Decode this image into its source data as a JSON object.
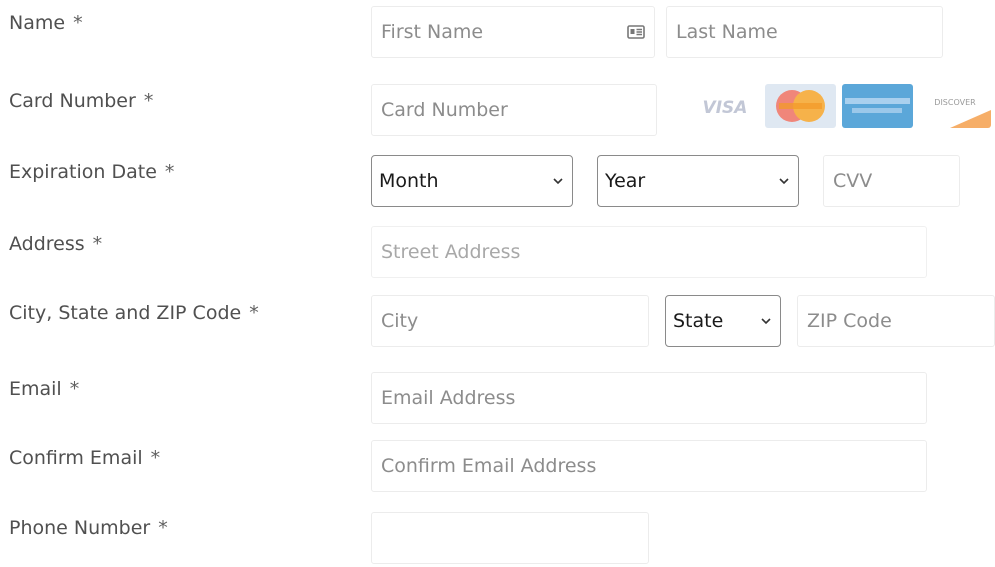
{
  "form": {
    "name": {
      "label": "Name",
      "required_mark": "*",
      "first_placeholder": "First Name",
      "last_placeholder": "Last Name"
    },
    "card_number": {
      "label": "Card Number",
      "required_mark": "*",
      "placeholder": "Card Number",
      "accepted_cards": [
        "visa-card-icon",
        "mastercard-card-icon",
        "amex-card-icon",
        "discover-card-icon"
      ],
      "visa_text": "VISA",
      "discover_text": "DISCOVER"
    },
    "expiration": {
      "label": "Expiration Date",
      "required_mark": "*",
      "month_value": "Month",
      "year_value": "Year",
      "cvv_placeholder": "CVV"
    },
    "address": {
      "label": "Address",
      "required_mark": "*",
      "placeholder": "Street Address"
    },
    "city_state_zip": {
      "label": "City, State and ZIP Code",
      "required_mark": "*",
      "city_placeholder": "City",
      "state_value": "State",
      "zip_placeholder": "ZIP Code"
    },
    "email": {
      "label": "Email",
      "required_mark": "*",
      "placeholder": "Email Address"
    },
    "confirm_email": {
      "label": "Confirm Email",
      "required_mark": "*",
      "placeholder": "Confirm Email Address"
    },
    "phone": {
      "label": "Phone Number",
      "required_mark": "*",
      "value": ""
    }
  },
  "colors": {
    "label_text": "#505050",
    "placeholder_text": "#8c8c8c",
    "input_border": "#ececec",
    "select_border": "#8a8a8a",
    "select_text": "#1a1a1a",
    "mastercard_orange": "#f39a2a",
    "amex_blue": "#5ba7d9",
    "discover_orange": "#f28c28"
  }
}
